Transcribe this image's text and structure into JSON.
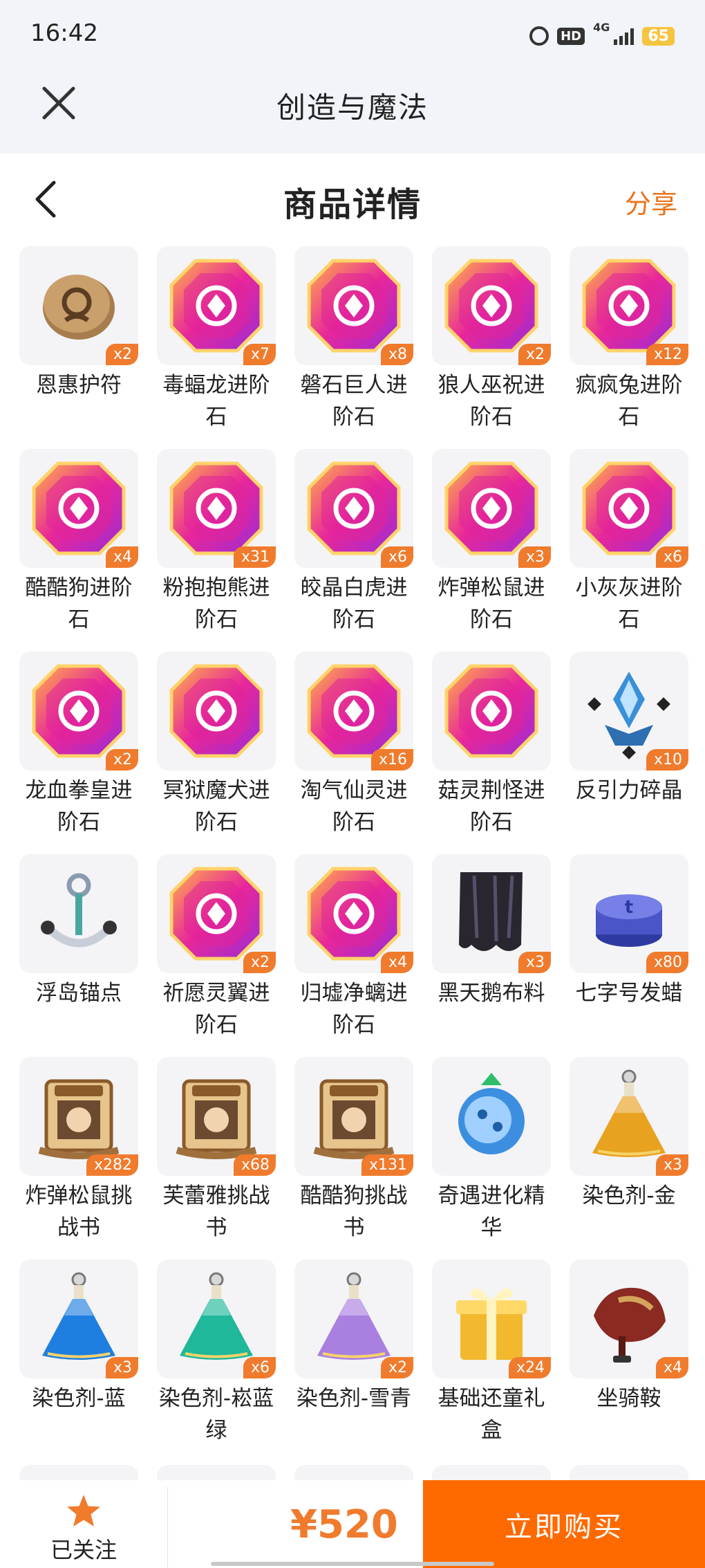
{
  "status_bar": {
    "time": "16:42",
    "hd": "HD",
    "network": "4G",
    "battery": "65"
  },
  "app": {
    "title": "创造与魔法",
    "close_icon": "close-icon"
  },
  "nav": {
    "title": "商品详情",
    "share": "分享",
    "back_icon": "chevron-left-icon"
  },
  "items": [
    {
      "name": "恩惠护符",
      "qty": "x2",
      "icon": "amulet",
      "color": "#b08a5a"
    },
    {
      "name": "毒蝠龙进阶石",
      "qty": "x7",
      "icon": "gem",
      "color": "#e8279a"
    },
    {
      "name": "磐石巨人进阶石",
      "qty": "x8",
      "icon": "gem",
      "color": "#e8279a"
    },
    {
      "name": "狼人巫祝进阶石",
      "qty": "x2",
      "icon": "gem",
      "color": "#e8279a"
    },
    {
      "name": "疯疯兔进阶石",
      "qty": "x12",
      "icon": "gem",
      "color": "#e8279a"
    },
    {
      "name": "酷酷狗进阶石",
      "qty": "x4",
      "icon": "gem",
      "color": "#e8279a"
    },
    {
      "name": "粉抱抱熊进阶石",
      "qty": "x31",
      "icon": "gem",
      "color": "#e8279a"
    },
    {
      "name": "皎晶白虎进阶石",
      "qty": "x6",
      "icon": "gem",
      "color": "#e8279a"
    },
    {
      "name": "炸弹松鼠进阶石",
      "qty": "x3",
      "icon": "gem",
      "color": "#e8279a"
    },
    {
      "name": "小灰灰进阶石",
      "qty": "x6",
      "icon": "gem",
      "color": "#e8279a"
    },
    {
      "name": "龙血拳皇进阶石",
      "qty": "x2",
      "icon": "gem",
      "color": "#e8279a"
    },
    {
      "name": "冥狱魔犬进阶石",
      "qty": "",
      "icon": "gem",
      "color": "#e8279a"
    },
    {
      "name": "淘气仙灵进阶石",
      "qty": "x16",
      "icon": "gem",
      "color": "#e8279a"
    },
    {
      "name": "菇灵荆怪进阶石",
      "qty": "",
      "icon": "gem",
      "color": "#e8279a"
    },
    {
      "name": "反引力碎晶",
      "qty": "x10",
      "icon": "crystal",
      "color": "#3a8fd9"
    },
    {
      "name": "浮岛锚点",
      "qty": "",
      "icon": "anchor",
      "color": "#4aa6a0"
    },
    {
      "name": "祈愿灵翼进阶石",
      "qty": "x2",
      "icon": "gem",
      "color": "#e8279a"
    },
    {
      "name": "归墟净螭进阶石",
      "qty": "x4",
      "icon": "gem",
      "color": "#e8279a"
    },
    {
      "name": "黑天鹅布料",
      "qty": "x3",
      "icon": "cloth",
      "color": "#2a2630"
    },
    {
      "name": "七字号发蜡",
      "qty": "x80",
      "icon": "wax",
      "color": "#4a56c8"
    },
    {
      "name": "炸弹松鼠挑战书",
      "qty": "x282",
      "icon": "scroll",
      "color": "#b57a3c"
    },
    {
      "name": "芙蕾雅挑战书",
      "qty": "x68",
      "icon": "scroll",
      "color": "#b57a3c"
    },
    {
      "name": "酷酷狗挑战书",
      "qty": "x131",
      "icon": "scroll",
      "color": "#b57a3c"
    },
    {
      "name": "奇遇进化精华",
      "qty": "",
      "icon": "essence",
      "color": "#3c8fe0"
    },
    {
      "name": "染色剂-金",
      "qty": "x3",
      "icon": "potion",
      "color": "#e8a21f"
    },
    {
      "name": "染色剂-蓝",
      "qty": "x3",
      "icon": "potion",
      "color": "#1f7fe0"
    },
    {
      "name": "染色剂-崧蓝绿",
      "qty": "x6",
      "icon": "potion",
      "color": "#1fb89a"
    },
    {
      "name": "染色剂-雪青",
      "qty": "x2",
      "icon": "potion",
      "color": "#a97fe0"
    },
    {
      "name": "基础还童礼盒",
      "qty": "x24",
      "icon": "giftbox",
      "color": "#f2b82e"
    },
    {
      "name": "坐骑鞍",
      "qty": "x4",
      "icon": "saddle",
      "color": "#8a2a22"
    }
  ],
  "bottom_bar": {
    "follow_label": "已关注",
    "price": "¥520",
    "buy_label": "立即购买",
    "accent": "#f07b2d",
    "buy_color": "#ff6a00"
  }
}
